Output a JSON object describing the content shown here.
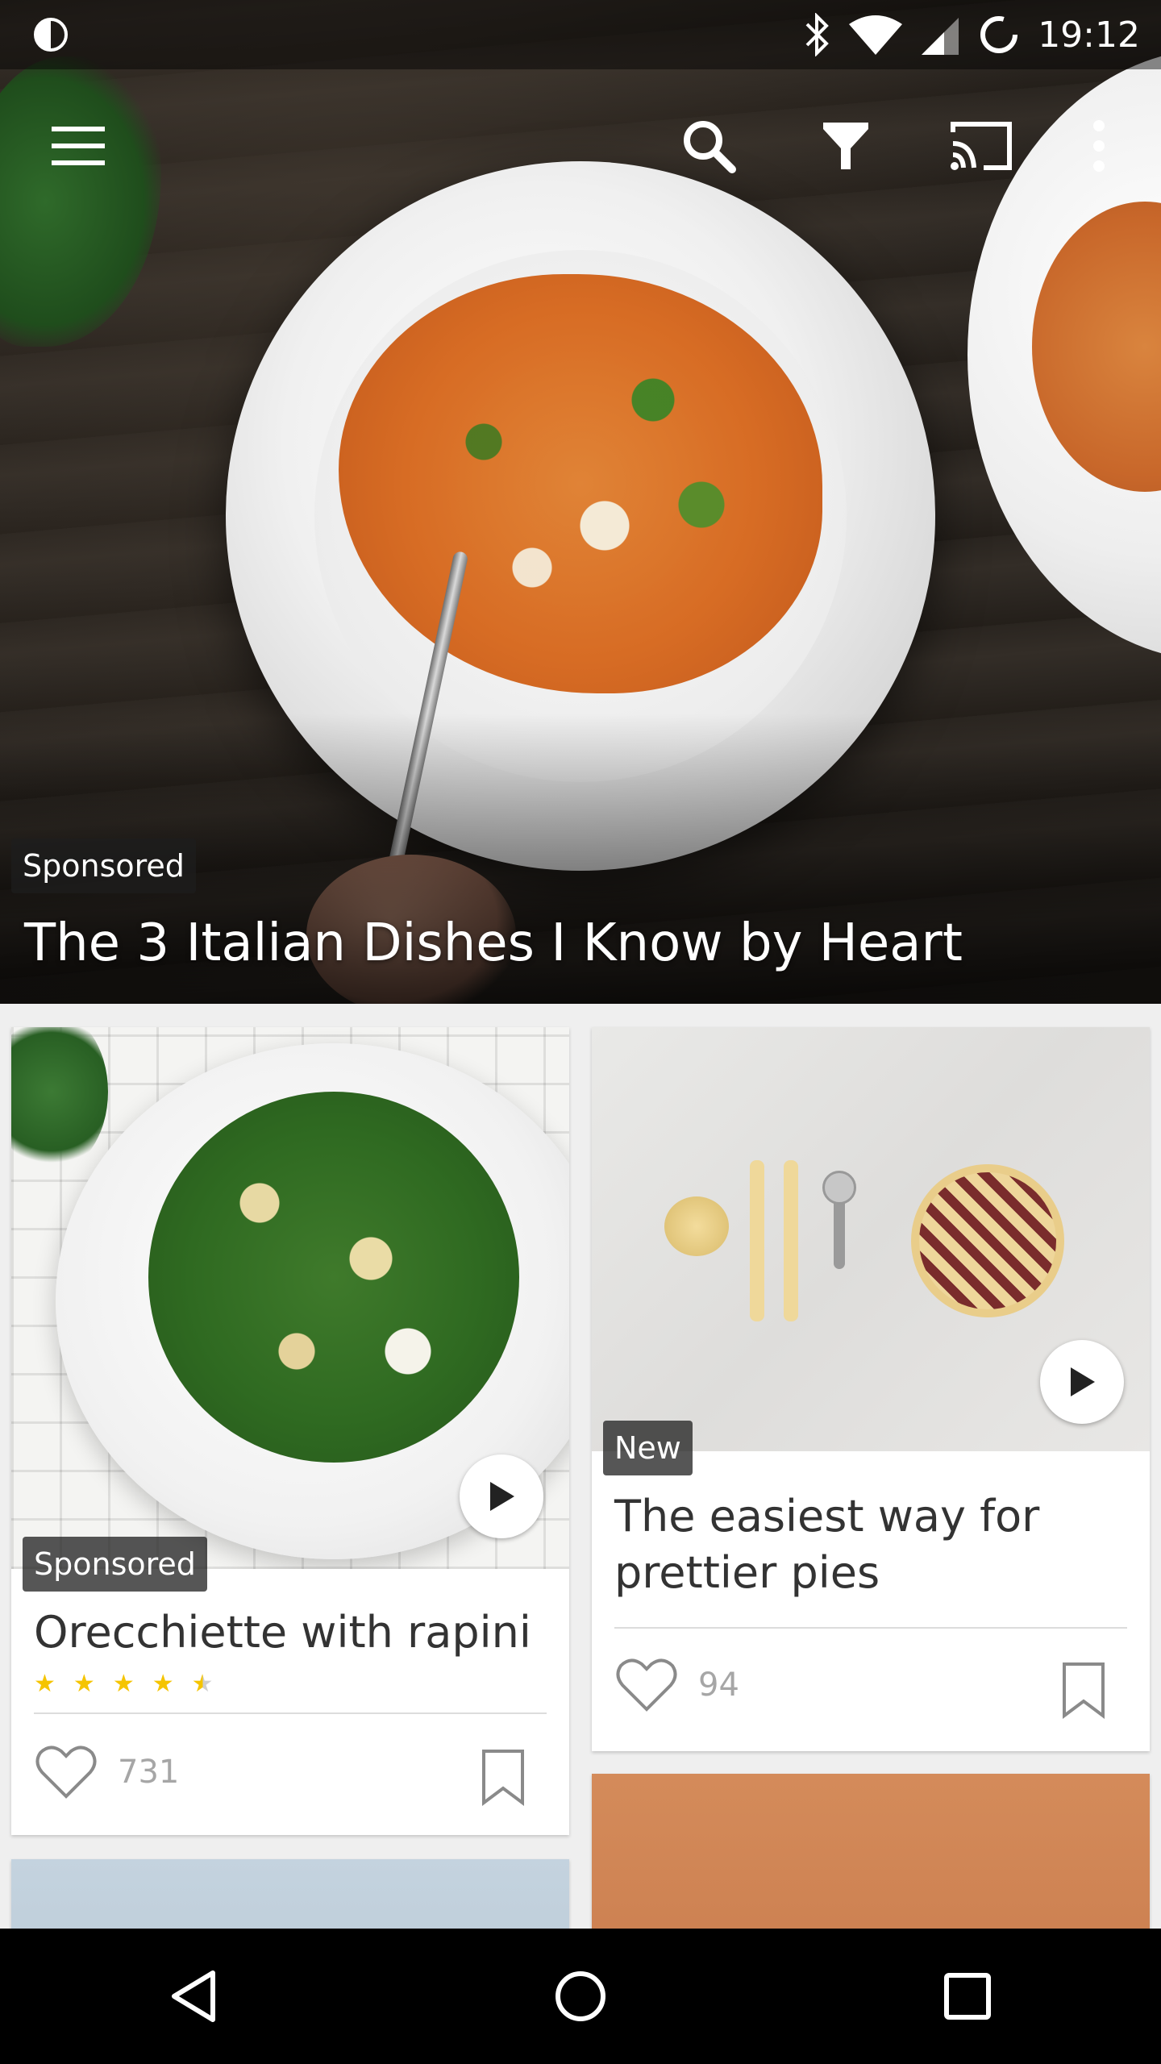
{
  "status_bar": {
    "time": "19:12",
    "icons": [
      "brightness-icon",
      "bluetooth-icon",
      "wifi-icon",
      "signal-icon",
      "sync-icon"
    ]
  },
  "toolbar": {
    "icons": [
      "menu-icon",
      "search-icon",
      "filter-icon",
      "cast-icon",
      "more-icon"
    ]
  },
  "hero": {
    "badge": "Sponsored",
    "title": "The 3 Italian Dishes I Know by Heart"
  },
  "cards": [
    {
      "badge": "Sponsored",
      "title": "Orecchiette with rapini",
      "rating": 4.5,
      "likes": "731",
      "has_video": true
    },
    {
      "badge": "New",
      "title": "The easiest way for prettier pies",
      "likes": "94",
      "has_video": true
    }
  ],
  "colors": {
    "star": "#f5c400",
    "badge_bg": "#1e1e1e",
    "like_count": "#a6a6a6",
    "title_text": "#333333"
  },
  "nav_bar": {
    "icons": [
      "back-icon",
      "home-icon",
      "recents-icon"
    ]
  }
}
